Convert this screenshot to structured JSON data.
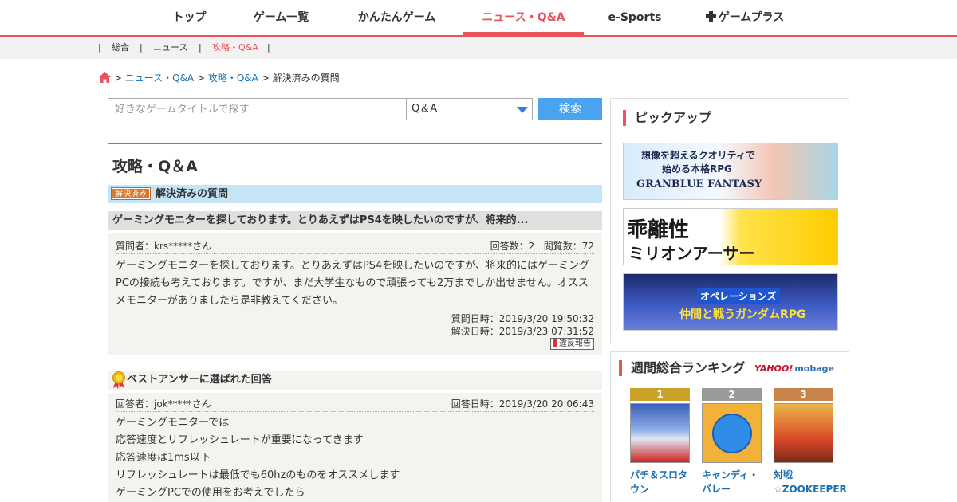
{
  "topnav": {
    "items": [
      {
        "label": "トップ"
      },
      {
        "label": "ゲーム一覧"
      },
      {
        "label": "かんたんゲーム"
      },
      {
        "label": "ニュース・Q&A"
      },
      {
        "label": "e-Sports"
      },
      {
        "label": "ゲームプラス"
      }
    ],
    "active_index": 3
  },
  "subnav": {
    "items": [
      {
        "label": "総合"
      },
      {
        "label": "ニュース"
      },
      {
        "label": "攻略・Q&A"
      }
    ],
    "separator": "|"
  },
  "breadcrumb": {
    "sep": ">",
    "items": [
      "ニュース・Q&A",
      "攻略・Q&A",
      "解決済みの質問"
    ]
  },
  "search": {
    "placeholder": "好きなゲームタイトルで探す",
    "category": "Q＆A",
    "button_label": "検索"
  },
  "main": {
    "title": "攻略・Q＆A",
    "section": {
      "badge": "解決済み",
      "title": "解決済みの質問"
    },
    "question": {
      "title": "ゲーミングモニターを探しております。とりあえずはPS4を映したいのですが、将来的...",
      "asker": "質問者：krs*****さん",
      "answers": "回答数：2",
      "views": "閲覧数：72",
      "body": "ゲーミングモニターを探しております。とりあえずはPS4を映したいのですが、将来的にはゲーミングPCの接続も考えております。ですが、まだ大学生なもので頑張っても2万までしか出せません。オススメモニターがありましたら是非教えてください。",
      "asked_at": "質問日時：2019/3/20 19:50:32",
      "resolved_at": "解決日時：2019/3/23 07:31:52",
      "report_label": "違反報告"
    },
    "best_answer": {
      "heading": "ベストアンサーに選ばれた回答",
      "answerer": "回答者：jok*****さん",
      "answered_at": "回答日時：2019/3/20 20:06:43",
      "lines": [
        "ゲーミングモニターでは",
        "応答速度とリフレッシュレートが重要になってきます",
        "応答速度は1ms以下",
        "リフレッシュレートは最低でも60hzのものをオススメします",
        "ゲーミングPCでの使用をお考えでしたら"
      ]
    }
  },
  "sidebar": {
    "pickup": {
      "title": "ピックアップ",
      "banners": [
        {
          "line1": "想像を超えるクオリティで",
          "line2": "始める本格RPG",
          "line3": "GRANBLUE FANTASY"
        },
        {
          "line1": "乖離性",
          "line2": "ミリオンアーサー"
        },
        {
          "line1": "オペレーションズ",
          "line2": "仲間と戦うガンダムRPG"
        }
      ]
    },
    "ranking": {
      "title": "週間総合ランキング",
      "logo_yahoo": "YAHOO!",
      "logo_mobage": "mobage",
      "items": [
        {
          "rank": "1",
          "name": "パチ＆スロタウン",
          "color": "#c9a227"
        },
        {
          "rank": "2",
          "name": "キャンディ・バレー",
          "color": "#9a9a9a"
        },
        {
          "rank": "3",
          "name": "対戦☆ZOOKEEPER",
          "color": "#c8834a"
        }
      ]
    }
  }
}
